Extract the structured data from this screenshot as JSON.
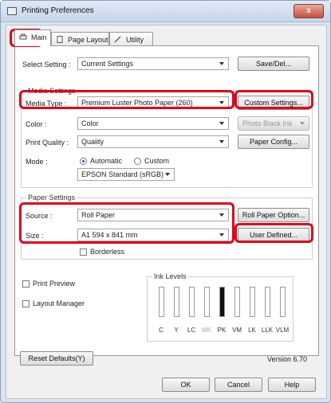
{
  "window": {
    "title": "Printing Preferences",
    "close_label": "x"
  },
  "tabs": [
    {
      "label": "Main",
      "active": true
    },
    {
      "label": "Page Layout",
      "active": false
    },
    {
      "label": "Utility",
      "active": false
    }
  ],
  "select_setting": {
    "label": "Select Setting :",
    "value": "Current Settings",
    "button": "Save/Del..."
  },
  "media_settings": {
    "title": "Media Settings",
    "media_type_label": "Media Type :",
    "media_type_value": "Premium Luster Photo Paper (260)",
    "custom_settings_button": "Custom Settings...",
    "color_label": "Color :",
    "color_value": "Color",
    "black_ink_value": "Photo Black Ink",
    "print_quality_label": "Print Quality :",
    "print_quality_value": "Quality",
    "paper_config_button": "Paper Config...",
    "mode_label": "Mode :",
    "mode_automatic": "Automatic",
    "mode_custom": "Custom",
    "mode_selected": "Automatic",
    "mode_value": "EPSON Standard (sRGB)"
  },
  "paper_settings": {
    "title": "Paper Settings",
    "source_label": "Source :",
    "source_value": "Roll Paper",
    "roll_paper_option_button": "Roll Paper Option...",
    "size_label": "Size :",
    "size_value": "A1 594 x 841 mm",
    "user_defined_button": "User Defined...",
    "borderless_label": "Borderless",
    "borderless_checked": false
  },
  "print_preview": {
    "label": "Print Preview",
    "checked": false
  },
  "layout_manager": {
    "label": "Layout Manager",
    "checked": false
  },
  "ink_levels": {
    "title": "Ink Levels",
    "inks": [
      {
        "label": "C",
        "level": 0.0,
        "color": "#ffffff"
      },
      {
        "label": "Y",
        "level": 0.0,
        "color": "#ffffff"
      },
      {
        "label": "LC",
        "level": 0.0,
        "color": "#ffffff"
      },
      {
        "label": "MK",
        "level": 0.0,
        "color": "#ffffff",
        "dimmed": true
      },
      {
        "label": "PK",
        "level": 1.0,
        "color": "#111111"
      },
      {
        "label": "VM",
        "level": 0.0,
        "color": "#ffffff"
      },
      {
        "label": "LK",
        "level": 0.0,
        "color": "#ffffff"
      },
      {
        "label": "LLK",
        "level": 0.0,
        "color": "#ffffff"
      },
      {
        "label": "VLM",
        "level": 0.0,
        "color": "#ffffff"
      }
    ]
  },
  "footer": {
    "reset_button": "Reset Defaults(Y)",
    "version": "Version 6.70"
  },
  "dialog_buttons": {
    "ok": "OK",
    "cancel": "Cancel",
    "help": "Help"
  },
  "colors": {
    "highlight": "#e2001a",
    "window_frame": "#d9e4f0"
  }
}
